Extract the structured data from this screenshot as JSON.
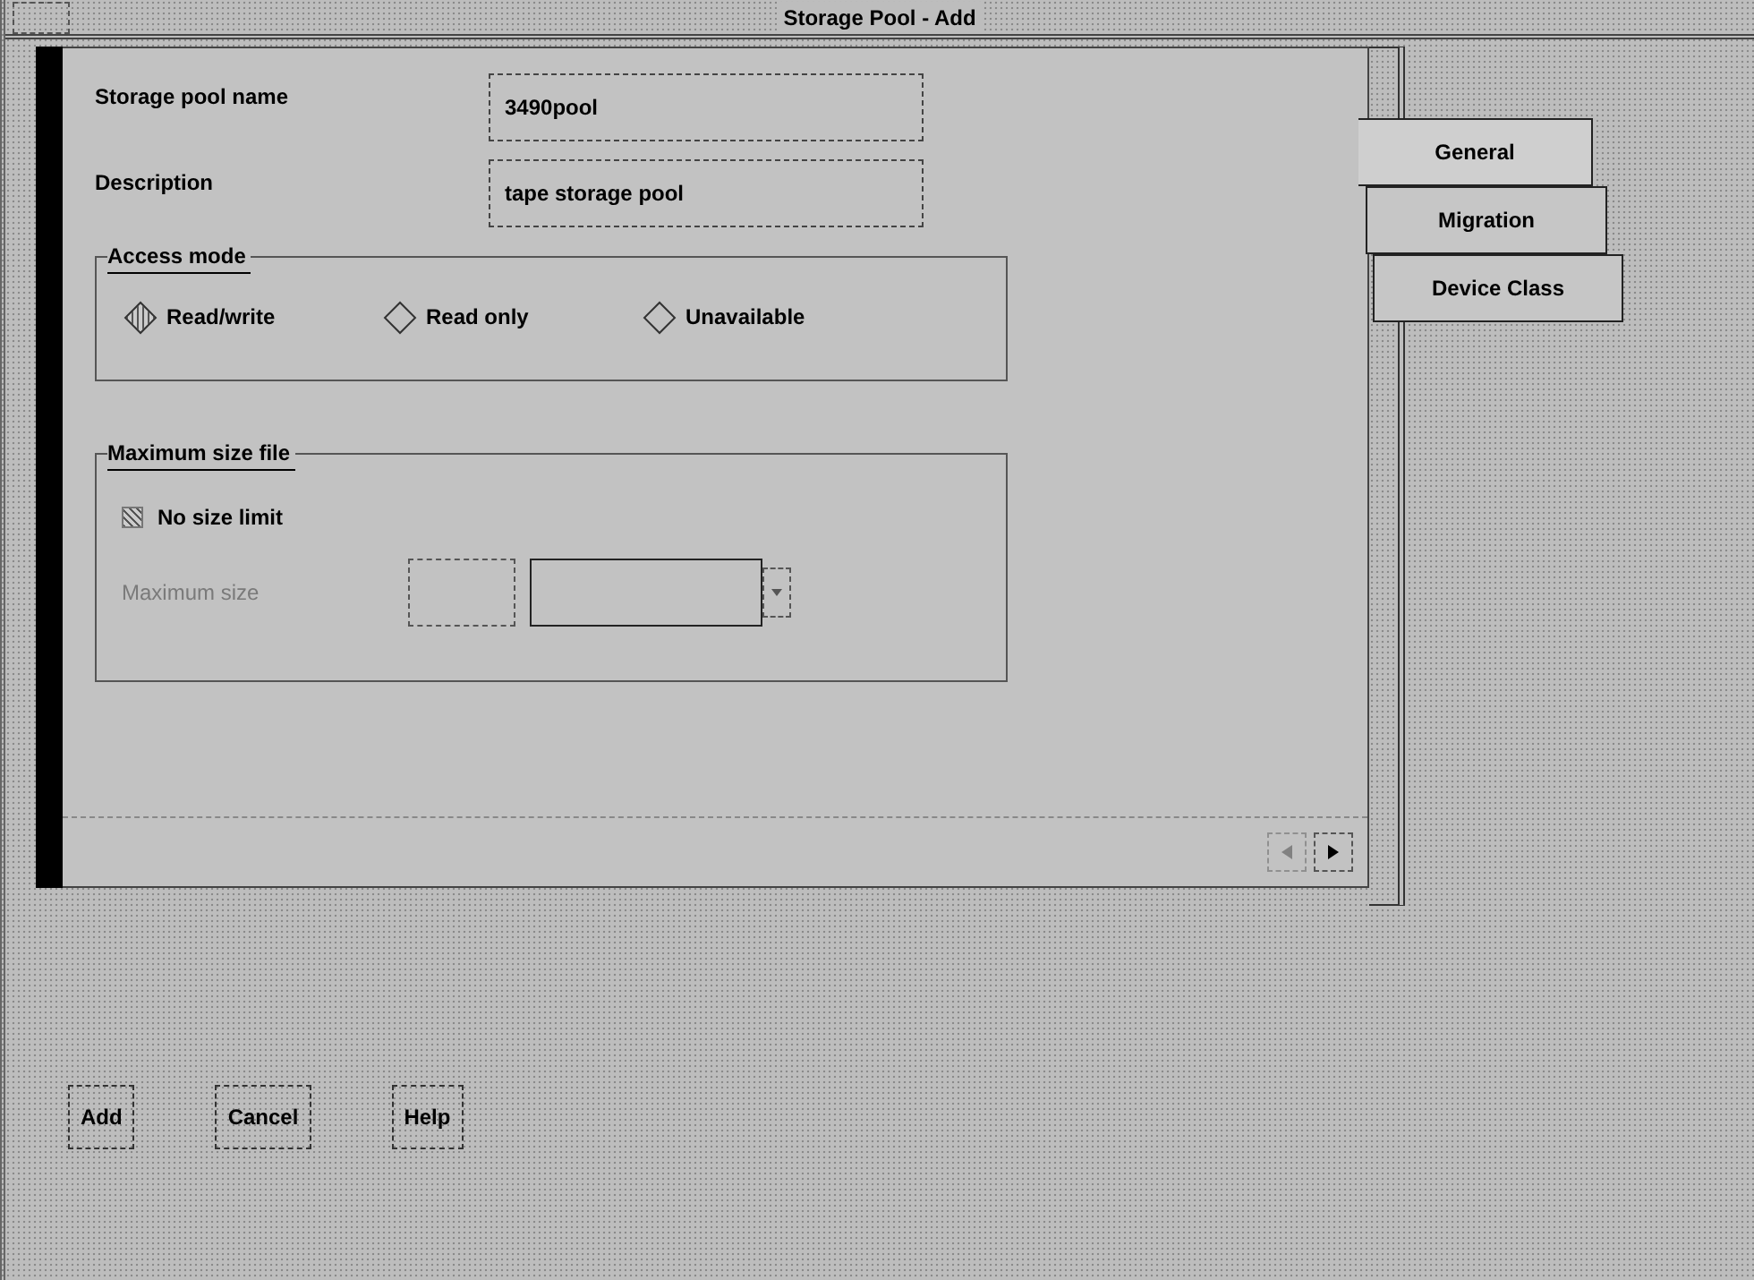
{
  "window": {
    "title": "Storage Pool - Add"
  },
  "fields": [
    {
      "label": "Storage pool name",
      "value": "3490pool"
    },
    {
      "label": "Description",
      "value": "tape storage pool"
    }
  ],
  "access_mode": {
    "title": "Access mode",
    "options": [
      {
        "label": "Read/write",
        "selected": true
      },
      {
        "label": "Read only",
        "selected": false
      },
      {
        "label": "Unavailable",
        "selected": false
      }
    ]
  },
  "max_size": {
    "title": "Maximum size file",
    "checkbox": {
      "label": "No size limit",
      "checked": true
    },
    "size_label": "Maximum size",
    "disabled": true
  },
  "page_nav": {
    "back_disabled": true
  },
  "tabs": [
    {
      "label": "General",
      "selected": true
    },
    {
      "label": "Migration",
      "selected": false
    },
    {
      "label": "Device Class",
      "selected": false
    }
  ],
  "buttons": [
    "Add",
    "Cancel",
    "Help"
  ]
}
